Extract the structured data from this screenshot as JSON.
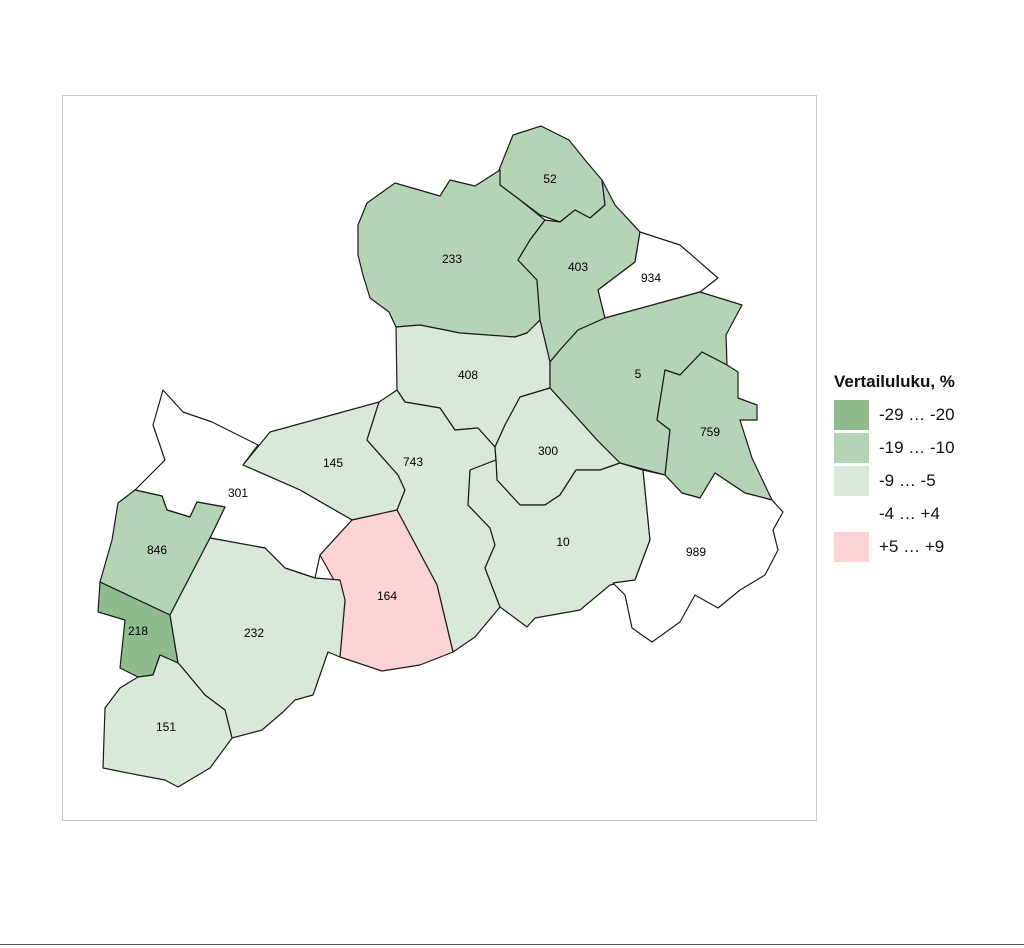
{
  "legend": {
    "title": "Vertailuluku, %",
    "classes": [
      {
        "id": "c1",
        "label": "-29 … -20",
        "color": "#8fbc8f"
      },
      {
        "id": "c2",
        "label": "-19 … -10",
        "color": "#b5d3b5"
      },
      {
        "id": "c3",
        "label": "-9 … -5",
        "color": "#dae8da"
      },
      {
        "id": "c4",
        "label": "-4 … +4",
        "color": "#ffffff"
      },
      {
        "id": "c5",
        "label": "+5 … +9",
        "color": "#fdd3d6"
      }
    ]
  },
  "regions": [
    {
      "code": "52",
      "class": "c2"
    },
    {
      "code": "233",
      "class": "c2"
    },
    {
      "code": "403",
      "class": "c2"
    },
    {
      "code": "934",
      "class": "c4"
    },
    {
      "code": "408",
      "class": "c3"
    },
    {
      "code": "5",
      "class": "c2"
    },
    {
      "code": "759",
      "class": "c2"
    },
    {
      "code": "145",
      "class": "c3"
    },
    {
      "code": "743",
      "class": "c3"
    },
    {
      "code": "300",
      "class": "c3"
    },
    {
      "code": "301",
      "class": "c4"
    },
    {
      "code": "846",
      "class": "c2"
    },
    {
      "code": "10",
      "class": "c3"
    },
    {
      "code": "989",
      "class": "c4"
    },
    {
      "code": "164",
      "class": "c5"
    },
    {
      "code": "218",
      "class": "c1"
    },
    {
      "code": "232",
      "class": "c3"
    },
    {
      "code": "151",
      "class": "c3"
    }
  ]
}
